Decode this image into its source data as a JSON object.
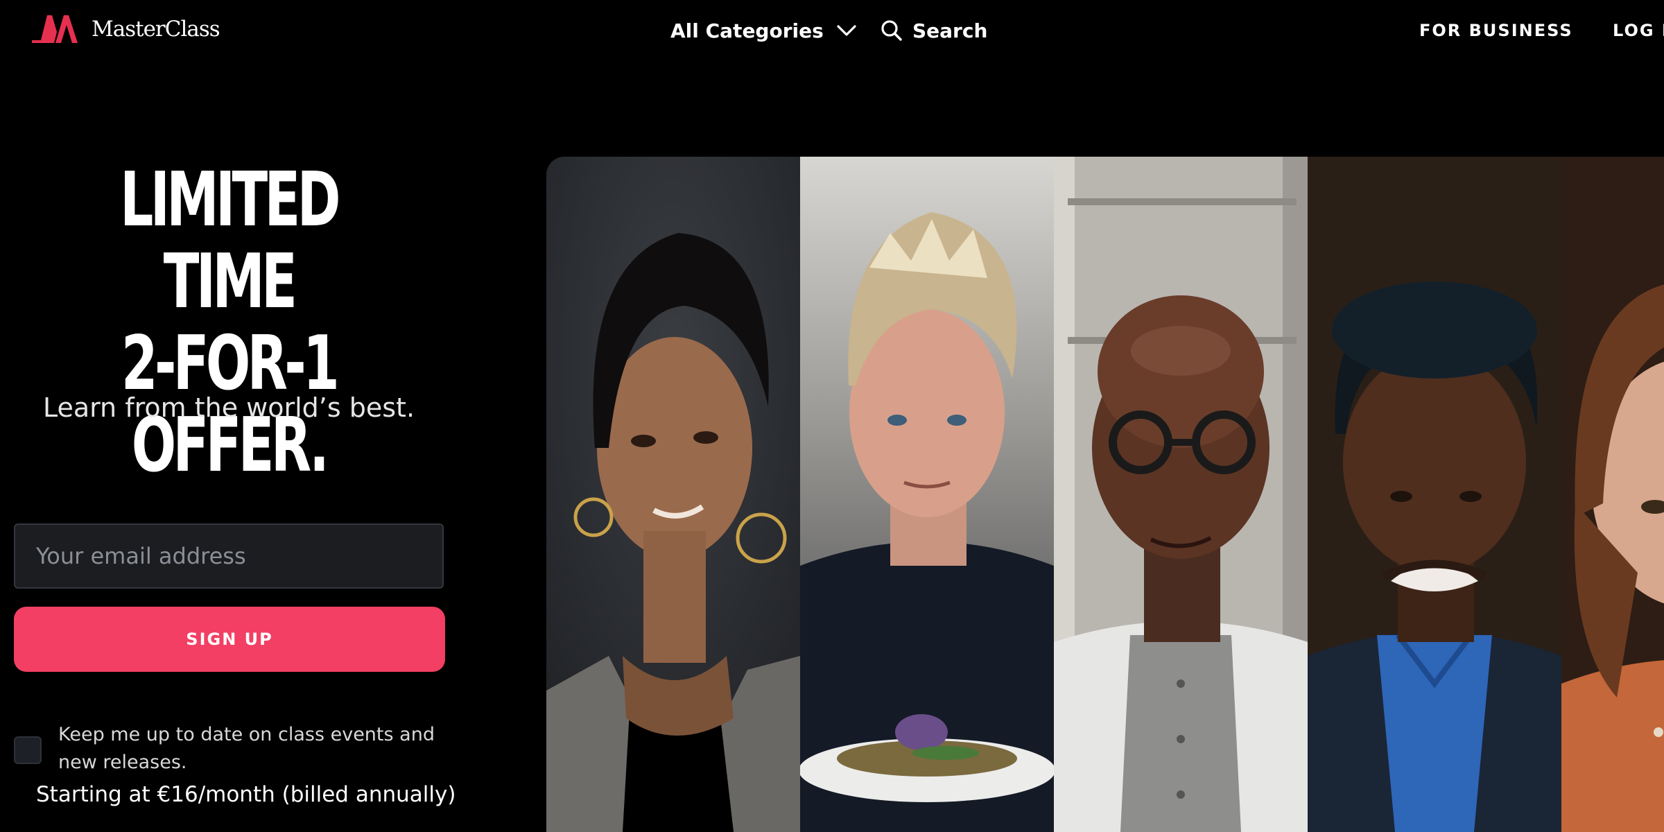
{
  "nav": {
    "brand": "MasterClass",
    "categories_label": "All Categories",
    "search_label": "Search",
    "business_label": "FOR BUSINESS",
    "login_label": "LOG IN",
    "icons": [
      "masterclass-logo-icon",
      "chevron-down-icon",
      "search-icon"
    ]
  },
  "hero": {
    "headline_line1": "LIMITED TIME",
    "headline_line2": "2-FOR-1 OFFER.",
    "subhead": "Learn from the world’s best.",
    "email_placeholder": "Your email address",
    "email_value": "",
    "signup_label": "SIGN UP",
    "consent_label": "Keep me up to date on class events and new releases.",
    "consent_checked": false,
    "pricing": "Starting at €16/month (billed annually)"
  },
  "instructors": {
    "panel_count_visible": 5,
    "items": [
      {
        "id": "instructor-1"
      },
      {
        "id": "instructor-2"
      },
      {
        "id": "instructor-3"
      },
      {
        "id": "instructor-4"
      },
      {
        "id": "instructor-5"
      }
    ]
  },
  "colors": {
    "background": "#000000",
    "accent": "#f23f63",
    "input_bg": "#1b1d21",
    "text_primary": "#ffffff",
    "text_muted": "#8c8f96"
  }
}
